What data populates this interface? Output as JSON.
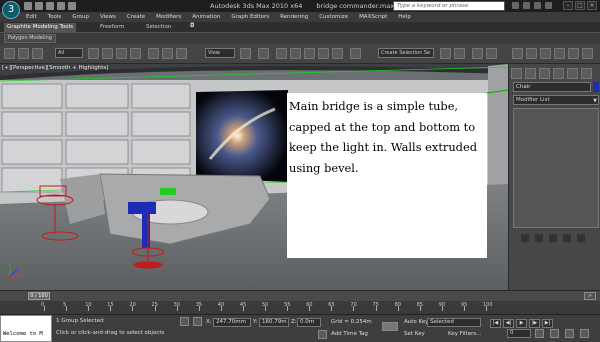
{
  "app": {
    "title": "Autodesk 3ds Max  2010 x64",
    "file": "bridge commander.max",
    "search_placeholder": "Type a keyword or phrase",
    "logo_glyph": "3"
  },
  "menu": [
    "Edit",
    "Tools",
    "Group",
    "Views",
    "Create",
    "Modifiers",
    "Animation",
    "Graph Editors",
    "Rendering",
    "Customize",
    "MAXScript",
    "Help"
  ],
  "ribbon": {
    "tabs": [
      "Graphite Modeling Tools",
      "Freeform",
      "Selection"
    ],
    "subtab": "Polygon Modeling"
  },
  "toolbar": {
    "filter": "All",
    "ref_coord": "View",
    "selection_set": "Create Selection Se"
  },
  "viewport": {
    "label": "[+][Perspective][Smooth + Highlights]",
    "note": "Main bridge is a simple tube, capped at the top and bottom to keep the light in. Walls extruded using bevel."
  },
  "command_panel": {
    "object_name": "Chair",
    "object_color": "#1c2fb0",
    "modifier_list": "Modifier List"
  },
  "timeline": {
    "frame": "0 / 100",
    "ticks": [
      "0",
      "5",
      "10",
      "15",
      "20",
      "25",
      "30",
      "35",
      "40",
      "45",
      "50",
      "55",
      "60",
      "65",
      "70",
      "75",
      "80",
      "85",
      "90",
      "95",
      "100"
    ]
  },
  "status": {
    "maxscript": "Welcome to M",
    "selection": "1 Group Selected",
    "prompt": "Click or click-and-drag to select objects",
    "x_label": "X:",
    "x_value": "247.70mm",
    "y_label": "Y:",
    "y_value": "160.79m",
    "z_label": "Z:",
    "z_value": "0.0m",
    "grid": "Grid = 0.254m",
    "add_time_tag": "Add Time Tag",
    "auto_key": "Auto Key",
    "auto_key_mode": "Selected",
    "set_key": "Set Key",
    "key_filters": "Key Filters...",
    "current_frame": "0"
  }
}
